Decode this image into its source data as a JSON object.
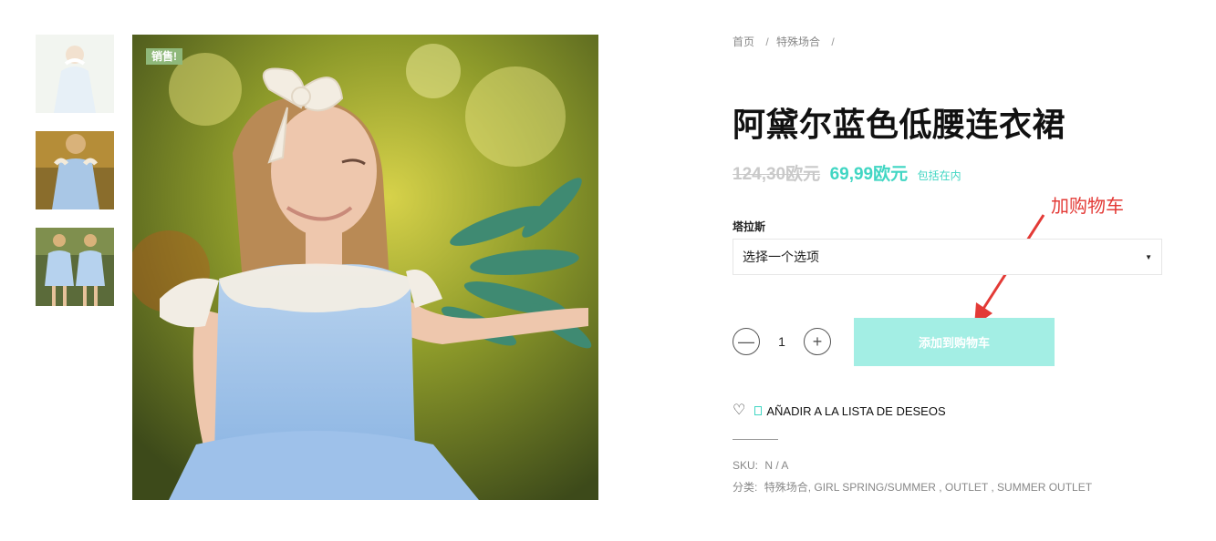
{
  "product": {
    "sale_badge": "销售!",
    "title": "阿黛尔蓝色低腰连衣裙",
    "old_price": "124,30欧元",
    "new_price": "69,99欧元",
    "tax_note": "包括在内"
  },
  "breadcrumb": {
    "items": [
      "首页",
      "特殊场合"
    ],
    "separator": "/"
  },
  "variant": {
    "label": "塔拉斯",
    "select_value": "选择一个选项"
  },
  "quantity": {
    "minus": "—",
    "value": "1",
    "plus": "+"
  },
  "actions": {
    "add_to_cart": "添加到购物车",
    "wishlist": "AÑADIR A LA LISTA DE DESEOS"
  },
  "annotation": {
    "text": "加购物车",
    "color": "#e33a36"
  },
  "meta": {
    "sku_label": "SKU:",
    "sku_value": "N / A",
    "category_label": "分类:",
    "categories": "特殊场合, GIRL SPRING/SUMMER , OUTLET , SUMMER OUTLET"
  },
  "colors": {
    "accent": "#41d6c3",
    "button_bg": "#a3eee4",
    "badge_bg": "#8fb87a"
  },
  "icons": [
    "heart-icon",
    "caret-down-icon",
    "minus-icon",
    "plus-icon",
    "arrow-icon"
  ]
}
